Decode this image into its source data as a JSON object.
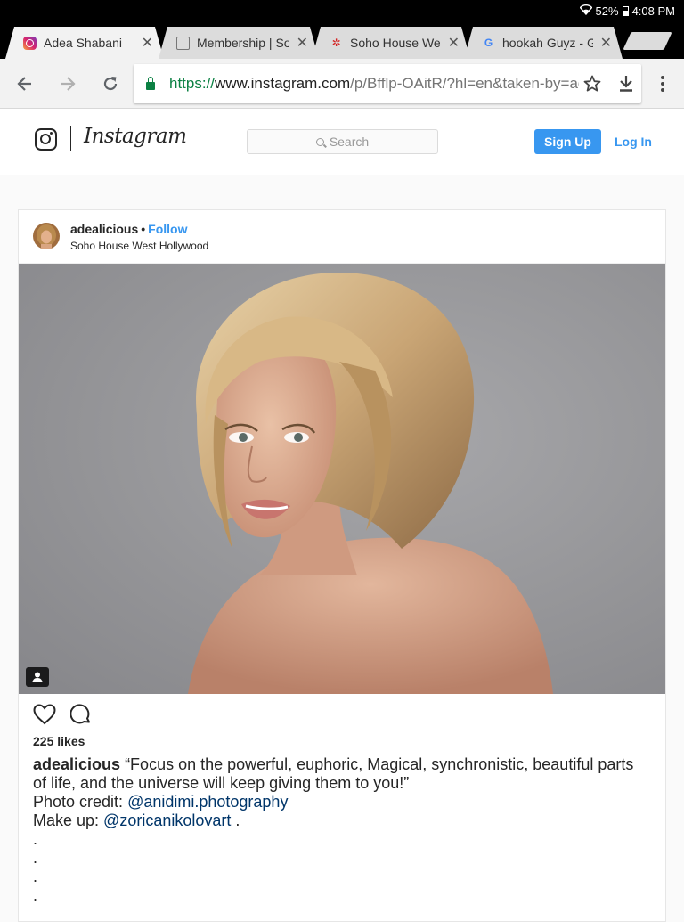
{
  "status_bar": {
    "battery": "52%",
    "time": "4:08 PM"
  },
  "tabs": [
    {
      "title": "Adea Shabani",
      "favicon": "instagram-icon",
      "active": true
    },
    {
      "title": "Membership | So",
      "favicon": "mail-icon",
      "active": false
    },
    {
      "title": "Soho House Wes",
      "favicon": "yelp-icon",
      "active": false
    },
    {
      "title": "hookah Guyz - Go",
      "favicon": "google-icon",
      "active": false
    }
  ],
  "omnibox": {
    "scheme": "https://",
    "host": "www.instagram.com",
    "path": "/p/Bfflp-OAitR/?hl=en&taken-by=ade"
  },
  "instagram_header": {
    "wordmark": "Instagram",
    "search_placeholder": "Search",
    "signup_label": "Sign Up",
    "login_label": "Log In"
  },
  "post": {
    "username": "adealicious",
    "separator": "•",
    "follow_label": "Follow",
    "location": "Soho House West Hollywood",
    "likes": "225 likes",
    "caption": {
      "username": "adealicious",
      "text": "“Focus on the powerful, euphoric, Magical, synchronistic, beautiful parts of life, and the universe will keep giving them to you!”",
      "credit_label": "Photo credit: ",
      "credit_mention": "@anidimi.photography",
      "makeup_label": "Make up: ",
      "makeup_mention": "@zoricanikolovart",
      "makeup_suffix": " .",
      "dots": [
        ".",
        ".",
        ".",
        "."
      ]
    }
  },
  "colors": {
    "instagram_blue": "#3897f0",
    "secure_green": "#0b8043",
    "mention_blue": "#003569"
  }
}
